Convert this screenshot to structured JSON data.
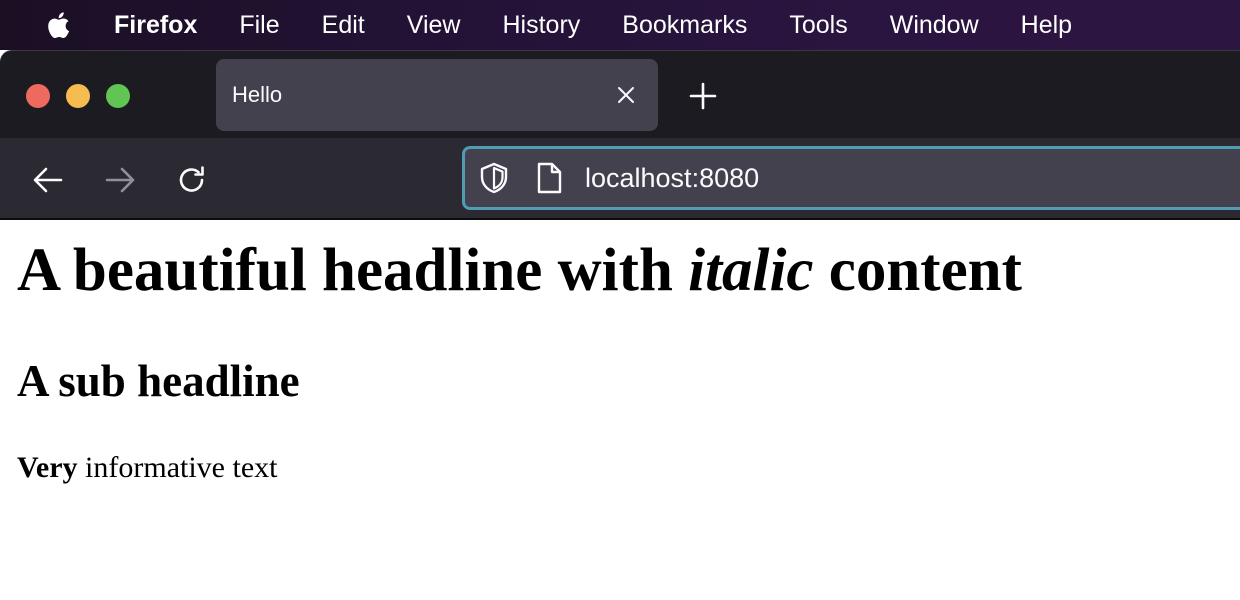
{
  "menubar": {
    "apple_icon": "apple-logo-icon",
    "items": [
      "Firefox",
      "File",
      "Edit",
      "View",
      "History",
      "Bookmarks",
      "Tools",
      "Window",
      "Help"
    ]
  },
  "window": {
    "traffic_lights": {
      "close": "#ee6a5f",
      "minimize": "#f5bd4f",
      "maximize": "#61c554"
    },
    "tab": {
      "title": "Hello",
      "close_icon": "close-icon"
    },
    "new_tab_icon": "plus-icon",
    "nav": {
      "back_icon": "arrow-left-icon",
      "forward_icon": "arrow-right-icon",
      "reload_icon": "reload-icon"
    },
    "urlbar": {
      "value": "localhost:8080",
      "shield_icon": "shield-icon",
      "page_icon": "page-icon",
      "focus_color": "#4f9cb3"
    }
  },
  "page": {
    "h1": {
      "before": "A beautiful headline with ",
      "italic": "italic",
      "after": " content"
    },
    "h2": "A sub headline",
    "paragraph": {
      "bold": "Very",
      "rest": " informative text"
    }
  }
}
